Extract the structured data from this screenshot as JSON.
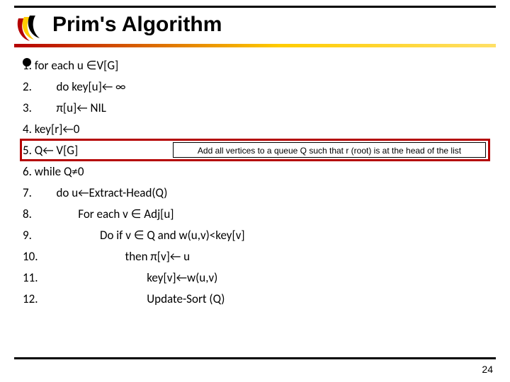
{
  "title": "Prim's Algorithm",
  "lines": [
    "1. for each u ∈V[G]",
    "2.         do key[u]← ∞",
    "3.         π[u]← NIL",
    "4. key[r]←0",
    "5. Q← V[G]",
    "6. while Q≠0",
    "7.         do u←Extract-Head(Q)",
    "8.                 For each v ∈ Adj[u]",
    "9.                         Do if v ∈ Q and w(u,v)<key[v]",
    "10.                                then π[v]← u",
    "11.                                        key[v]←w(u,v)",
    "12.                                        Update-Sort (Q)"
  ],
  "callout": "Add all vertices to a queue Q such that r (root) is at the head of the list",
  "page_number": "24",
  "logo_colors": {
    "red": "#b50000",
    "yellow": "#ffcc00",
    "black": "#000000"
  }
}
